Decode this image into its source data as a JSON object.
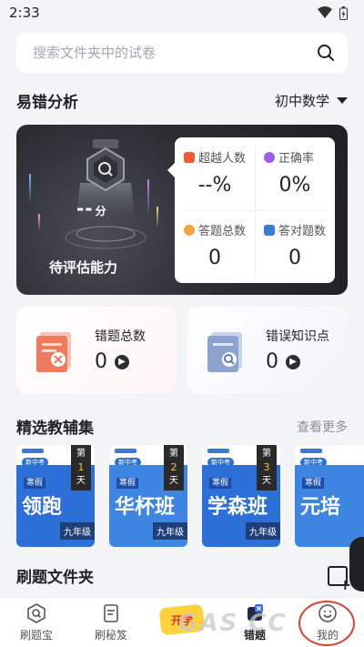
{
  "status_bar": {
    "time": "2:33"
  },
  "search": {
    "placeholder": "搜索文件夹中的试卷"
  },
  "analysis": {
    "title": "易错分析",
    "subject": "初中数学",
    "score": "--",
    "score_unit": "分",
    "ability_label": "待评估能力",
    "stats": [
      {
        "label": "超越人数",
        "value": "--%",
        "icon": "trophy-icon",
        "color": "#ef5a3c"
      },
      {
        "label": "正确率",
        "value": "0%",
        "icon": "pie-icon",
        "color": "#9b5de5"
      },
      {
        "label": "答题总数",
        "value": "0",
        "icon": "clock-icon",
        "color": "#f4a340"
      },
      {
        "label": "答对题数",
        "value": "0",
        "icon": "check-icon",
        "color": "#3a7bd5"
      }
    ]
  },
  "summary": {
    "wrong_total_label": "错题总数",
    "wrong_total_value": "0",
    "wrong_knowledge_label": "错误知识点",
    "wrong_knowledge_value": "0"
  },
  "books_section": {
    "title": "精选教辅集",
    "view_more": "查看更多",
    "books": [
      {
        "tag": "新中考",
        "season": "寒假",
        "name": "领跑",
        "grade": "九年级",
        "day_prefix": "第",
        "day_num": "1",
        "day_suffix": "天"
      },
      {
        "tag": "新中考",
        "season": "寒假",
        "name": "华杯班",
        "grade": "九年级",
        "day_prefix": "第",
        "day_num": "2",
        "day_suffix": "天"
      },
      {
        "tag": "新中考",
        "season": "寒假",
        "name": "学森班",
        "grade": "九年级",
        "day_prefix": "第",
        "day_num": "3",
        "day_suffix": "天"
      },
      {
        "tag": "新中考",
        "season": "寒假",
        "name": "元培",
        "grade": "",
        "day_prefix": "",
        "day_num": "",
        "day_suffix": ""
      }
    ]
  },
  "folder_section": {
    "title": "刷题文件夹"
  },
  "tabbar": {
    "tabs": [
      {
        "label": "刷题宝",
        "icon": "search-doc-icon"
      },
      {
        "label": "刷秘笈",
        "icon": "book-icon"
      },
      {
        "label": "错题",
        "icon": "wrong-book-icon"
      },
      {
        "label": "我的",
        "icon": "smile-icon"
      }
    ],
    "center_badge": "开学",
    "watermark": "GAS  CC"
  },
  "colors": {
    "accent_red": "#d9442e",
    "book_blue": "#2c6fd6",
    "card_dark": "#2b2d33"
  }
}
